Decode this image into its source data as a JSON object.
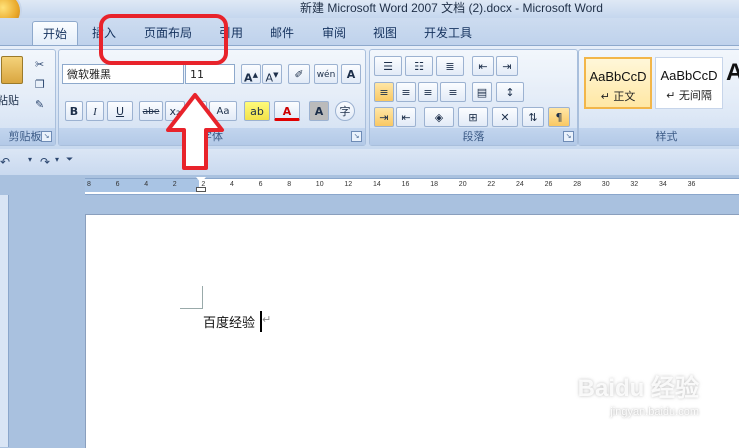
{
  "window": {
    "title": "新建 Microsoft Word 2007 文档 (2).docx - Microsoft Word"
  },
  "tabs": [
    {
      "label": "开始"
    },
    {
      "label": "插入"
    },
    {
      "label": "页面布局"
    },
    {
      "label": "引用"
    },
    {
      "label": "邮件"
    },
    {
      "label": "审阅"
    },
    {
      "label": "视图"
    },
    {
      "label": "开发工具"
    }
  ],
  "clipboard": {
    "paste_label": "粘贴",
    "group_label": "剪贴板"
  },
  "font": {
    "font_name": "微软雅黑",
    "font_size": "11",
    "group_label": "字体",
    "bold": "B",
    "italic": "I",
    "underline": "U",
    "strike": "abe",
    "aa": "Aa",
    "A": "A"
  },
  "paragraph": {
    "group_label": "段落"
  },
  "styles": {
    "group_label": "样式",
    "items": [
      {
        "sample": "AaBbCcD",
        "name": "↵ 正文"
      },
      {
        "sample": "AaBbCcD",
        "name": "↵ 无间隔"
      },
      {
        "sample": "A",
        "name": ""
      }
    ]
  },
  "ruler": {
    "ticks": [
      "8",
      "6",
      "4",
      "2",
      "2",
      "4",
      "6",
      "8",
      "10",
      "12",
      "14",
      "16",
      "18",
      "20",
      "22",
      "24",
      "26",
      "28",
      "30",
      "32",
      "34",
      "36"
    ]
  },
  "document": {
    "text": "百度经验",
    "paragraph_mark": "↵"
  },
  "watermark": {
    "logo": "Baidu 经验",
    "url": "jingyan.baidu.com"
  },
  "colors": {
    "accent": "#15325e",
    "annotation": "#e8232b"
  }
}
